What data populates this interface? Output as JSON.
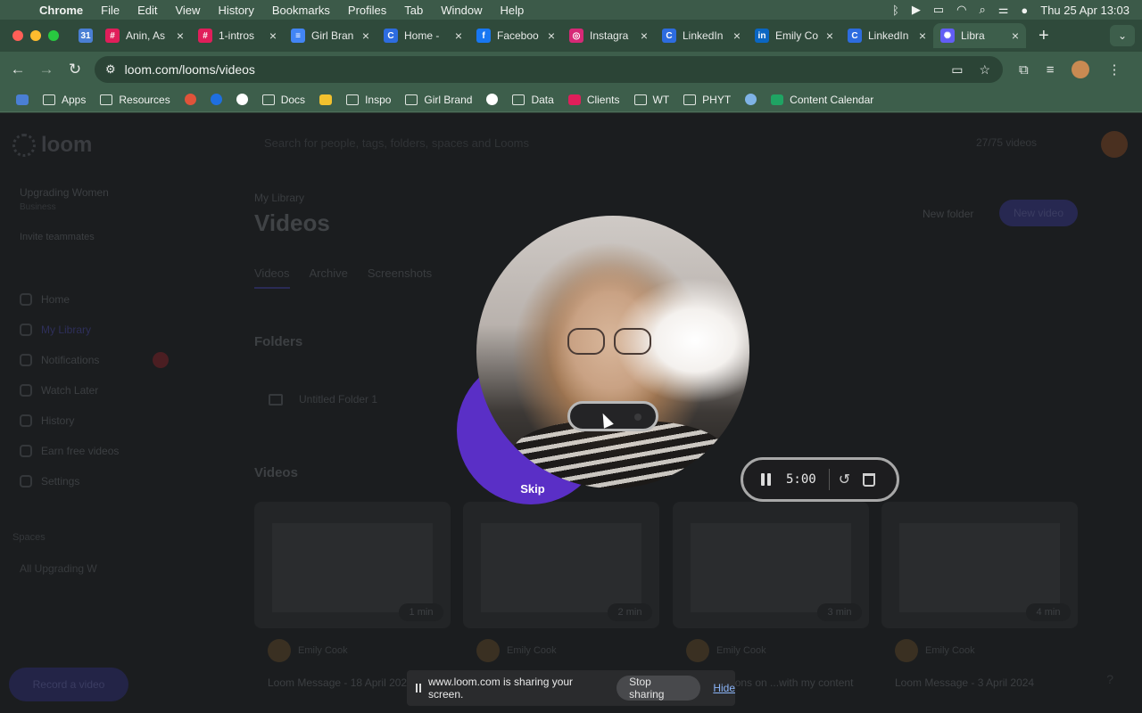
{
  "menubar": {
    "app": "Chrome",
    "items": [
      "File",
      "Edit",
      "View",
      "History",
      "Bookmarks",
      "Profiles",
      "Tab",
      "Window",
      "Help"
    ],
    "datetime": "Thu 25 Apr  13:03"
  },
  "tabs": [
    {
      "title": "",
      "color": "#4a7fd4",
      "glyph": "31"
    },
    {
      "title": "Anin, As",
      "color": "#e01e5a",
      "glyph": "#"
    },
    {
      "title": "1-intros",
      "color": "#e01e5a",
      "glyph": "#"
    },
    {
      "title": "Girl Bran",
      "color": "#4285f4",
      "glyph": "≡"
    },
    {
      "title": "Home -",
      "color": "#2d6cdf",
      "glyph": "C"
    },
    {
      "title": "Faceboo",
      "color": "#1877f2",
      "glyph": "f"
    },
    {
      "title": "Instagra",
      "color": "#d62976",
      "glyph": "◎"
    },
    {
      "title": "LinkedIn",
      "color": "#2d6cdf",
      "glyph": "C"
    },
    {
      "title": "Emily Co",
      "color": "#0a66c2",
      "glyph": "in"
    },
    {
      "title": "LinkedIn",
      "color": "#2d6cdf",
      "glyph": "C"
    },
    {
      "title": "Libra",
      "color": "#625df5",
      "glyph": "✺",
      "active": true
    }
  ],
  "address": {
    "url": "loom.com/looms/videos"
  },
  "bookmarks": [
    {
      "label": "",
      "kind": "sq",
      "color": "#4a7fd4"
    },
    {
      "label": "Apps",
      "kind": "folder"
    },
    {
      "label": "Resources",
      "kind": "folder"
    },
    {
      "label": "",
      "kind": "circ",
      "color": "#e0533a"
    },
    {
      "label": "",
      "kind": "circ",
      "color": "#1f6fe0"
    },
    {
      "label": "",
      "kind": "circ",
      "color": "#ffffff"
    },
    {
      "label": "Docs",
      "kind": "folder"
    },
    {
      "label": "",
      "kind": "sq",
      "color": "#f2c12e"
    },
    {
      "label": "Inspo",
      "kind": "folder"
    },
    {
      "label": "Girl Brand",
      "kind": "folder"
    },
    {
      "label": "",
      "kind": "circ",
      "color": "#ffffff"
    },
    {
      "label": "Data",
      "kind": "folder"
    },
    {
      "label": "Clients",
      "kind": "sq",
      "color": "#e01e5a"
    },
    {
      "label": "WT",
      "kind": "folder"
    },
    {
      "label": "PHYT",
      "kind": "folder"
    },
    {
      "label": "",
      "kind": "circ",
      "color": "#7fb3e6"
    },
    {
      "label": "Content Calendar",
      "kind": "sq",
      "color": "#1fa463"
    }
  ],
  "loom": {
    "logo": "loom",
    "workspace": "Upgrading Women",
    "workspace_sub": "Business",
    "invite": "Invite teammates",
    "nav": [
      "Home",
      "My Library",
      "Notifications",
      "Watch Later",
      "History",
      "Earn free videos",
      "Settings"
    ],
    "spaces_label": "Spaces",
    "space_item": "All Upgrading W",
    "record_button": "Record a video",
    "search_placeholder": "Search for people, tags, folders, spaces and Looms",
    "search_count": "27/75 videos",
    "breadcrumb": "My Library",
    "page_title": "Videos",
    "new_folder": "New folder",
    "new_video": "New video",
    "tabs": [
      "Videos",
      "Archive",
      "Screenshots"
    ],
    "folders_title": "Folders",
    "folder_name": "Untitled Folder 1",
    "videos_title": "Videos",
    "videos": [
      {
        "author": "Emily Cook",
        "title": "Loom Message - 18 April 2024",
        "duration": "1 min"
      },
      {
        "author": "Emily Cook",
        "title": "",
        "duration": "2 min"
      },
      {
        "author": "Emily Cook",
        "title": "...connections on ...with my content",
        "duration": "3 min"
      },
      {
        "author": "Emily Cook",
        "title": "Loom Message - 3 April 2024",
        "duration": "4 min"
      }
    ]
  },
  "recorder": {
    "skip_label": "Skip",
    "timer": "5:00"
  },
  "share_bar": {
    "message": "www.loom.com is sharing your screen.",
    "stop_label": "Stop sharing",
    "hide_label": "Hide"
  }
}
